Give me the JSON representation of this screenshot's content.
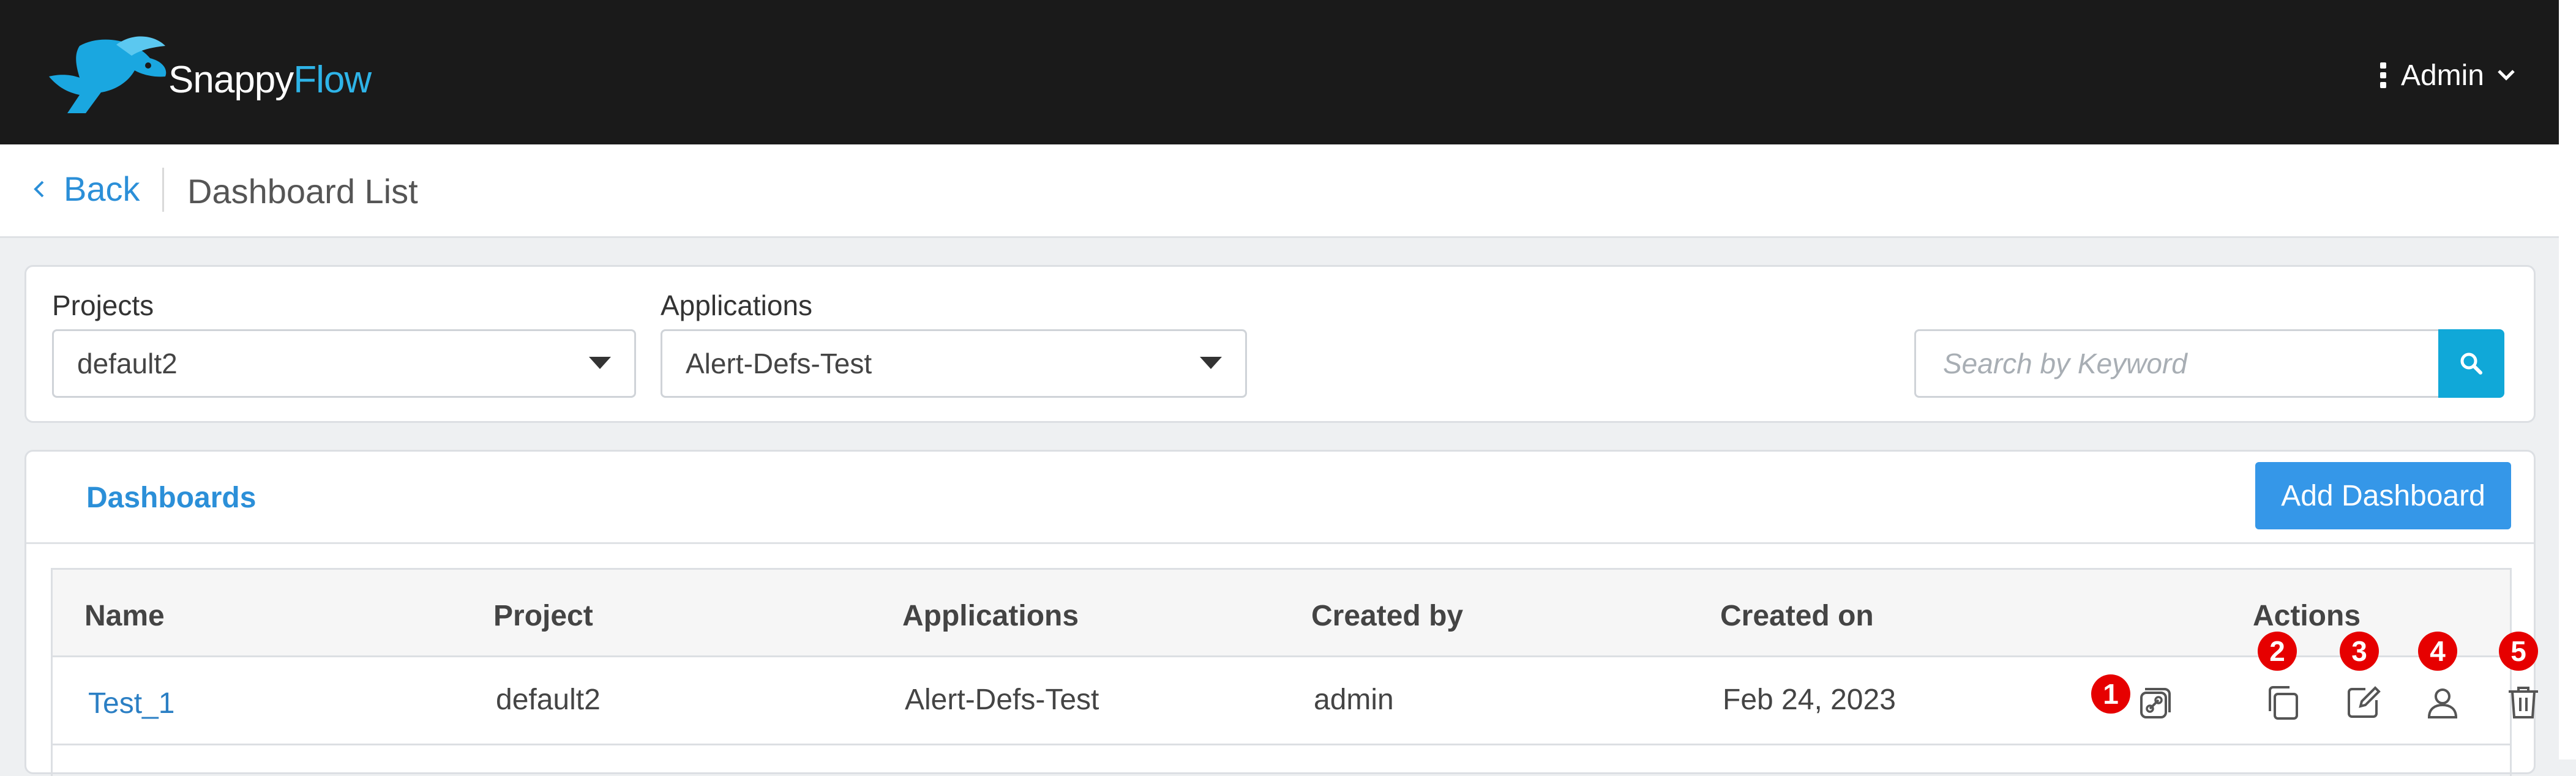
{
  "brand": {
    "name_part1": "Snappy",
    "name_part2": "Flow",
    "accent": "#2eb4e8"
  },
  "header": {
    "user_label": "Admin",
    "menu_icon": "kebab-icon",
    "dropdown_icon": "chevron-down-icon"
  },
  "subheader": {
    "back_label": "Back",
    "page_title": "Dashboard List"
  },
  "filters": {
    "projects_label": "Projects",
    "projects_value": "default2",
    "applications_label": "Applications",
    "applications_value": "Alert-Defs-Test",
    "search_placeholder": "Search by Keyword"
  },
  "dashboards": {
    "tab_label": "Dashboards",
    "add_button": "Add Dashboard",
    "columns": [
      "Name",
      "Project",
      "Applications",
      "Created by",
      "Created on",
      "Actions"
    ],
    "rows": [
      {
        "name": "Test_1",
        "project": "default2",
        "applications": "Alert-Defs-Test",
        "created_by": "admin",
        "created_on": "Feb 24, 2023"
      }
    ],
    "action_icons": [
      "link-icon",
      "copy-icon",
      "edit-icon",
      "user-icon",
      "trash-icon"
    ],
    "badges": [
      "1",
      "2",
      "3",
      "4",
      "5"
    ]
  },
  "colors": {
    "topbar": "#1a1a1a",
    "primary_button": "#3597e8",
    "search_button": "#10a8d8",
    "badge": "#e60000",
    "link": "#2b8fd8"
  }
}
